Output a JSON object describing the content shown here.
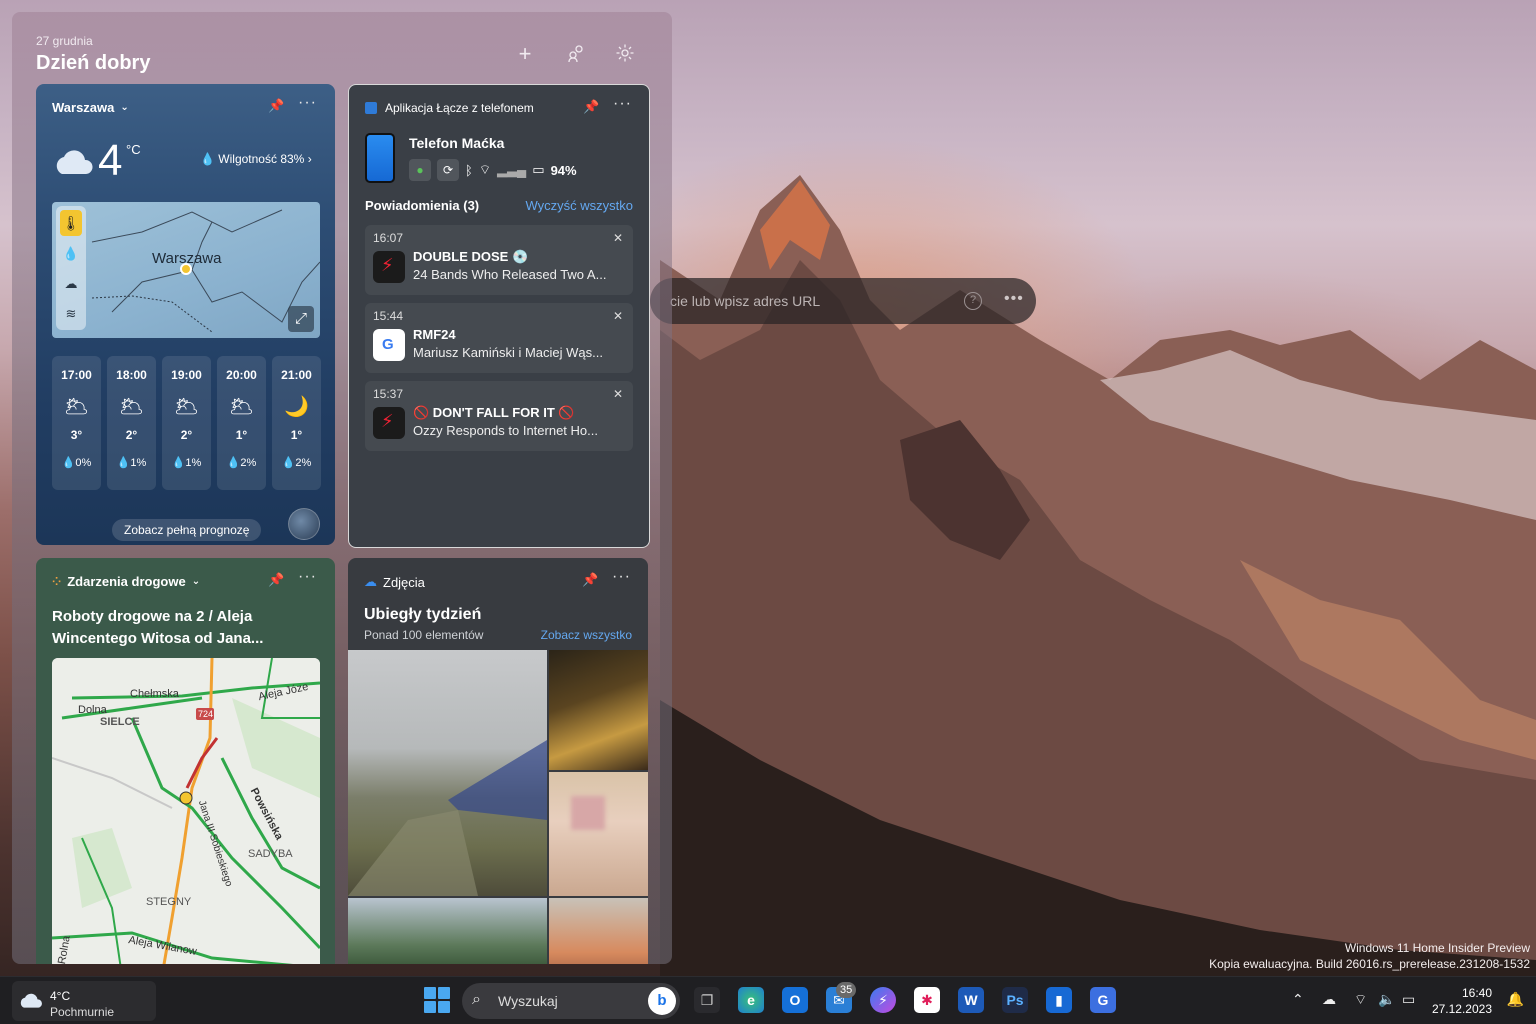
{
  "desktop": {
    "address_bar_text": "cie lub wpisz adres URL",
    "watermark": [
      "Windows 11 Home Insider Preview",
      "Kopia ewaluacyjna. Build 26016.rs_prerelease.231208-1532"
    ]
  },
  "widgets": {
    "date": "27 grudnia",
    "greeting": "Dzień dobry",
    "weather": {
      "city": "Warszawa",
      "temp": "4",
      "unit": "°C",
      "humidity": "Wilgotność 83%",
      "map_city": "Warszawa",
      "hours": [
        {
          "time": "17:00",
          "icon": "partly-cloudy-icon",
          "temp": "3°",
          "precip": "0%"
        },
        {
          "time": "18:00",
          "icon": "partly-cloudy-icon",
          "temp": "2°",
          "precip": "1%"
        },
        {
          "time": "19:00",
          "icon": "partly-cloudy-icon",
          "temp": "2°",
          "precip": "1%"
        },
        {
          "time": "20:00",
          "icon": "partly-cloudy-icon",
          "temp": "1°",
          "precip": "2%"
        },
        {
          "time": "21:00",
          "icon": "cloudy-night-icon",
          "temp": "1°",
          "precip": "2%"
        }
      ],
      "full_forecast": "Zobacz pełną prognozę"
    },
    "phone": {
      "app_name": "Aplikacja Łącze z telefonem",
      "device": "Telefon Maćka",
      "battery": "94%",
      "notifications_label": "Powiadomienia (3)",
      "clear_all": "Wyczyść wszystko",
      "notifications": [
        {
          "time": "16:07",
          "title": "DOUBLE DOSE 💿",
          "body": "24 Bands Who Released Two A..."
        },
        {
          "time": "15:44",
          "title": "RMF24",
          "body": "Mariusz Kamiński i Maciej Wąs..."
        },
        {
          "time": "15:37",
          "title": "🚫 DON'T FALL FOR IT 🚫",
          "body": "Ozzy Responds to Internet Ho..."
        }
      ]
    },
    "traffic": {
      "title": "Zdarzenia drogowe",
      "headline": "Roboty drogowe na 2 / Aleja Wincentego Witosa od Jana...",
      "map_labels": [
        "Chełmska",
        "Dolna",
        "SIELCE",
        "Aleja Józe",
        "724",
        "Powsińska",
        "Jana III Sobieskiego",
        "SADYBA",
        "STEGNY",
        "Rolna",
        "Aleja Wilanow"
      ]
    },
    "photos": {
      "title": "Zdjęcia",
      "heading": "Ubiegły tydzień",
      "sub": "Ponad 100 elementów",
      "see_all": "Zobacz wszystko"
    }
  },
  "taskbar": {
    "weather_temp": "4°C",
    "weather_desc": "Pochmurnie",
    "search_placeholder": "Wyszukaj",
    "mail_badge": "35",
    "time": "16:40",
    "date": "27.12.2023"
  }
}
